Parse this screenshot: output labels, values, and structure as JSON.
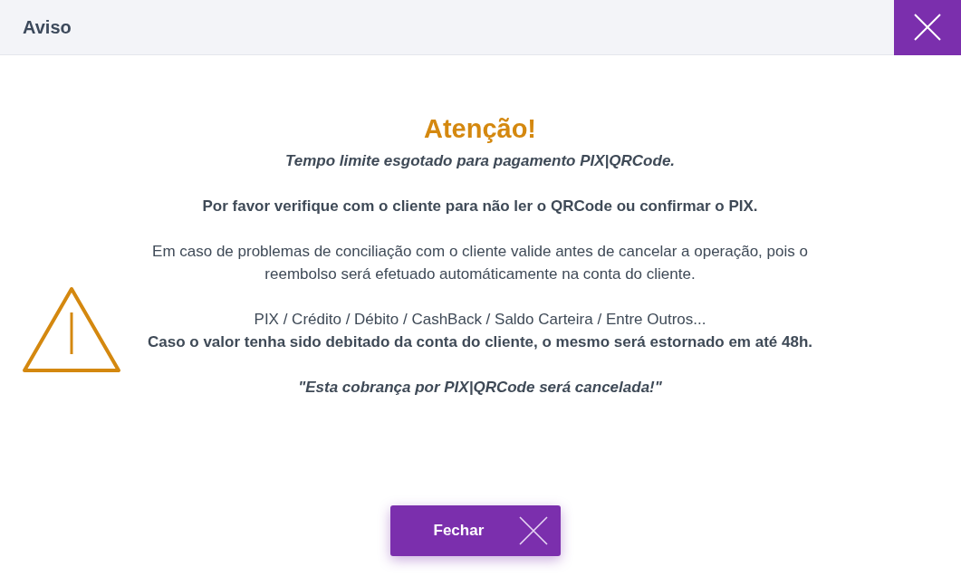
{
  "dialog": {
    "title": "Aviso"
  },
  "heading": "Atenção!",
  "paragraphs": [
    {
      "lines": [
        {
          "kind": "emphasis",
          "text": "Tempo limite esgotado para pagamento PIX|QRCode."
        }
      ]
    },
    {
      "lines": [
        {
          "kind": "strong",
          "text": "Por favor verifique com o cliente para não ler o QRCode ou confirmar o PIX."
        }
      ]
    },
    {
      "lines": [
        {
          "kind": "plain",
          "text": "Em caso de problemas de conciliação com o cliente valide antes de cancelar a operação, pois o reembolso será efetuado automáticamente na conta do cliente."
        }
      ]
    },
    {
      "lines": [
        {
          "kind": "plain",
          "text": "PIX / Crédito / Débito / CashBack / Saldo Carteira / Entre Outros..."
        },
        {
          "kind": "strong",
          "text": "Caso o valor tenha sido debitado da conta do cliente, o mesmo será estornado em até 48h."
        }
      ]
    },
    {
      "lines": [
        {
          "kind": "emphasis",
          "text": "\"Esta cobrança por PIX|QRCode será cancelada!\""
        }
      ]
    }
  ],
  "button": {
    "label": "Fechar"
  }
}
